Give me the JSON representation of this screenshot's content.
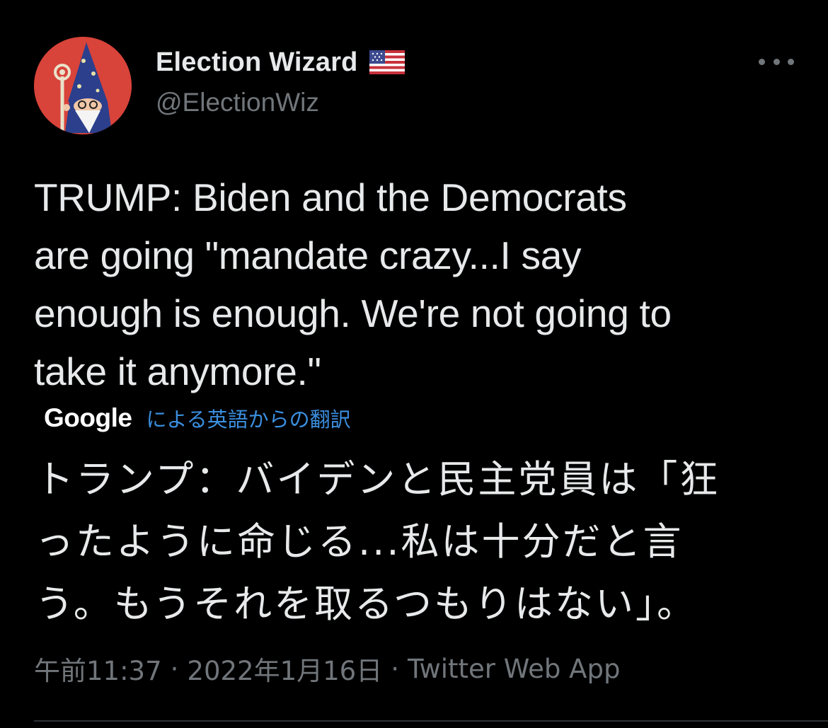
{
  "author": {
    "display_name": "Election Wizard",
    "flag_icon": "us-flag-icon",
    "handle": "@ElectionWiz",
    "avatar_icon": "wizard-avatar-icon",
    "avatar_bg": "#d8433a"
  },
  "menu": {
    "more_icon": "more-horizontal-icon"
  },
  "tweet": {
    "text": "TRUMP: Biden and the Democrats\nare going \"mandate crazy...I say\nenough is enough. We're not going to\ntake it anymore.\""
  },
  "translation": {
    "provider": "Google",
    "label": "による英語からの翻訳",
    "text": "トランプ：バイデンと民主党員は「狂\nったように命じる...私は十分だと言\nう。もうそれを取るつもりはない」。"
  },
  "meta": {
    "time": "午前11:37",
    "separator": "·",
    "date": "2022年1月16日",
    "source": "Twitter Web App"
  },
  "colors": {
    "background": "#000000",
    "text": "#e7e9ea",
    "secondary": "#71767b",
    "link": "#3b8fe0"
  }
}
